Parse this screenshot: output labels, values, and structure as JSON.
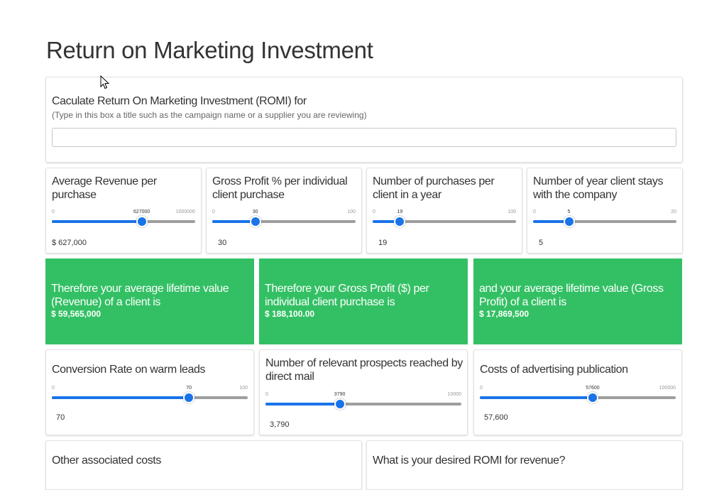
{
  "page": {
    "title": "Return on Marketing Investment"
  },
  "campaign": {
    "label": "Caculate Return On Marketing Investment (ROMI) for",
    "hint": "(Type in this box a title such as the campaign name or a supplier you are reviewing)",
    "value": ""
  },
  "sliders": {
    "avg_revenue": {
      "label": "Average Revenue per purchase",
      "min": "0",
      "max": "1000000",
      "tick": "627000",
      "fraction": 0.627,
      "value": "$  627,000"
    },
    "gross_profit": {
      "label": "Gross Profit % per individual client purchase",
      "min": "0",
      "max": "100",
      "tick": "30",
      "fraction": 0.3,
      "value": "30"
    },
    "purchases": {
      "label": "Number of purchases per client in a year",
      "min": "0",
      "max": "100",
      "tick": "19",
      "fraction": 0.19,
      "value": "19"
    },
    "years": {
      "label": "Number of year client stays with the company",
      "min": "0",
      "max": "20",
      "tick": "5",
      "fraction": 0.25,
      "value": "5"
    },
    "conversion": {
      "label": "Conversion Rate on warm leads",
      "min": "0",
      "max": "100",
      "tick": "70",
      "fraction": 0.7,
      "value": "70"
    },
    "prospects": {
      "label": "Number of relevant prospects reached by direct mail",
      "min": "0",
      "max": "10000",
      "tick": "3790",
      "fraction": 0.379,
      "value": "3,790"
    },
    "ad_costs": {
      "label": "Costs of advertising publication",
      "min": "0",
      "max": "100000",
      "tick": "57600",
      "fraction": 0.576,
      "value": "57,600"
    }
  },
  "results": {
    "lifetime_revenue": {
      "label": "Therefore your average lifetime value (Revenue) of a client is",
      "value": "$ 59,565,000"
    },
    "gross_profit_per_purchase": {
      "label": "Therefore your Gross Profit ($) per individual client purchase is",
      "value": "$ 188,100.00"
    },
    "lifetime_gross_profit": {
      "label": "and your average lifetime value (Gross Profit) of a client is",
      "value": "$ 17,869,500"
    }
  },
  "bottom": {
    "other_costs": {
      "label": "Other associated costs"
    },
    "desired_romi": {
      "label": "What is your desired ROMI for revenue?"
    }
  },
  "colors": {
    "accent": "#1a73e8",
    "result_bg": "#33c064",
    "track": "#9e9e9e"
  },
  "icons": {
    "cursor": "mouse-pointer-icon"
  }
}
